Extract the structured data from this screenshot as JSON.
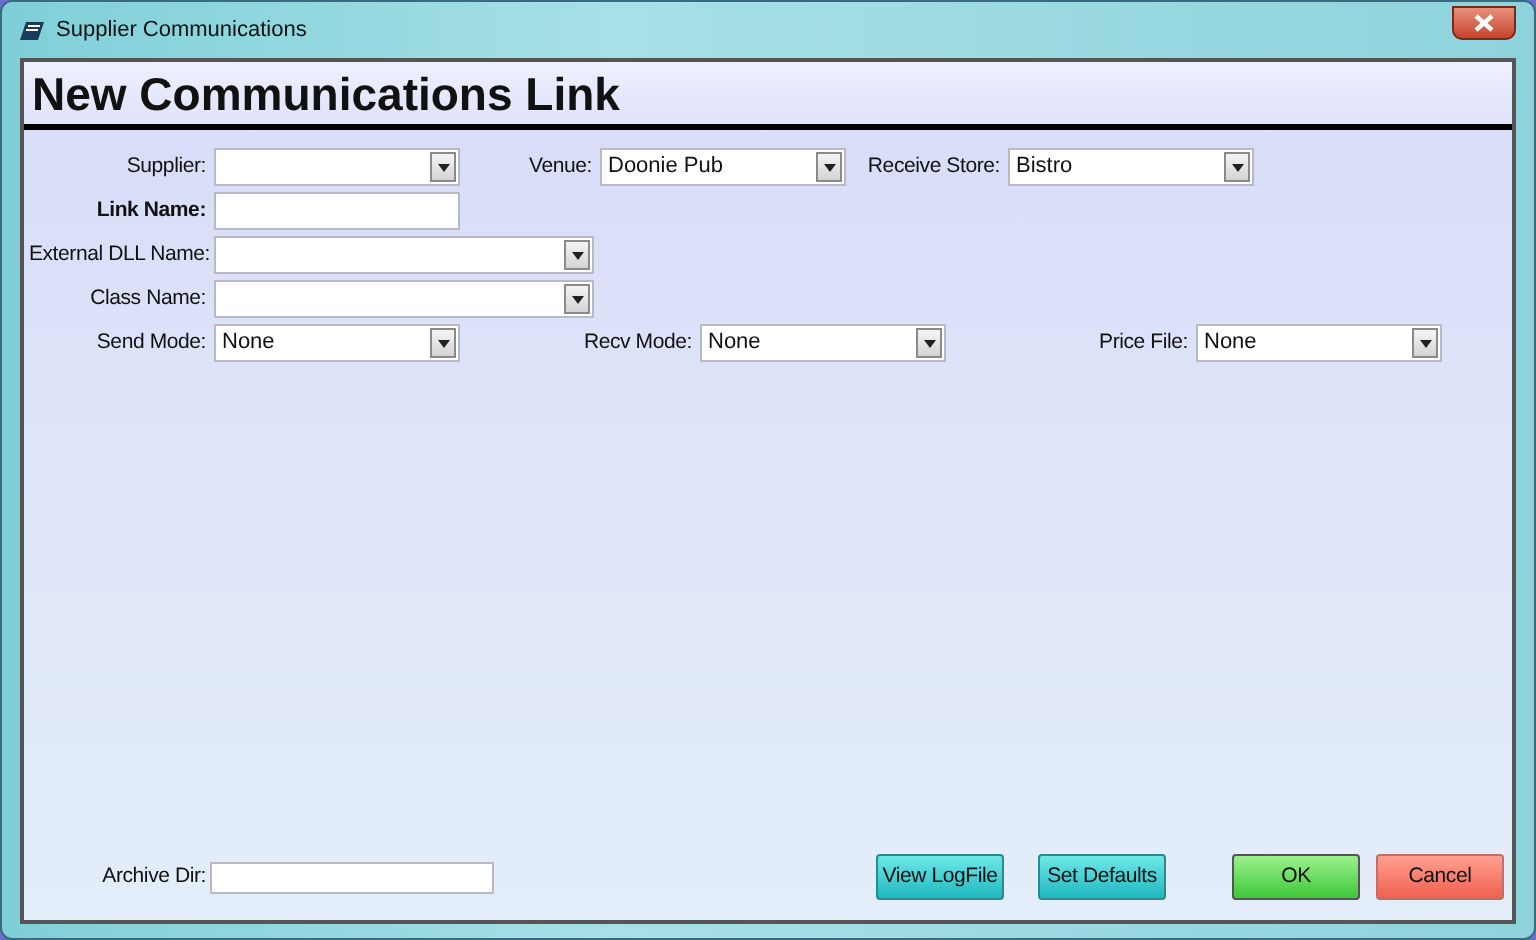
{
  "window": {
    "title": "Supplier Communications"
  },
  "header": "New Communications Link",
  "rows": [
    [
      {
        "label": "Supplier:",
        "kind": "combo"
      },
      {
        "label": "Venue:",
        "kind": "combo",
        "value": "Doonie Pub"
      },
      {
        "label": "Receive Store:",
        "kind": "combo",
        "value": "Bistro"
      }
    ],
    [
      {
        "label": "Link Name:",
        "kind": "text",
        "emphasized": true
      }
    ],
    [
      {
        "label": "External DLL Name:",
        "kind": "combo"
      }
    ],
    [
      {
        "label": "Class Name:",
        "kind": "combo"
      }
    ],
    [
      {
        "label": "Send Mode:",
        "kind": "combo",
        "value": "None"
      },
      {
        "label": "Recv Mode:",
        "kind": "combo",
        "value": "None"
      },
      {
        "label": "Price File:",
        "kind": "combo",
        "value": "None"
      }
    ]
  ],
  "archive": {
    "label": "Archive Dir:"
  },
  "buttons": [
    {
      "label": "View LogFile",
      "kind": "tool"
    },
    {
      "label": "Set Defaults",
      "kind": "tool"
    },
    {
      "label": "OK",
      "kind": "ok"
    },
    {
      "label": "Cancel",
      "kind": "cancel"
    }
  ]
}
